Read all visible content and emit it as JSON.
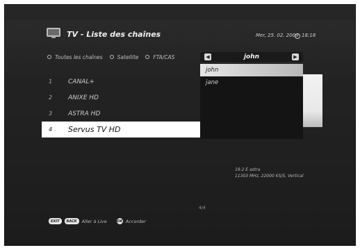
{
  "header": {
    "title": "TV - Liste des chaînes",
    "date": "Mer, 25. 02. 2009",
    "time": "18:18"
  },
  "filters": [
    {
      "label": "Toutes les chaînes"
    },
    {
      "label": "Satellite"
    },
    {
      "label": "FTA/CAS"
    }
  ],
  "list_selector": {
    "title": "john",
    "left_arrow": "◀",
    "right_arrow": "▶"
  },
  "channels": [
    {
      "num": "1",
      "name": "CANAL+"
    },
    {
      "num": "2",
      "name": "ANIXE HD"
    },
    {
      "num": "3",
      "name": "ASTRA HD"
    },
    {
      "num": "4",
      "name": "Servus TV HD"
    }
  ],
  "favorites": [
    "john",
    "jane"
  ],
  "satellite_info": {
    "line1": "19.2 E astra",
    "line2": "11303 MHz, 22000 KS/S, Vertical"
  },
  "pager": "4/4",
  "footer": {
    "exit_key": "EXIT",
    "back_key": "BACK",
    "back_label": "Aller à Live",
    "ok_key": "OK",
    "ok_label": "Accorder"
  },
  "colors": {
    "background": "#1e1e1e",
    "selected_row": "#ffffff",
    "text": "#cccccc"
  }
}
